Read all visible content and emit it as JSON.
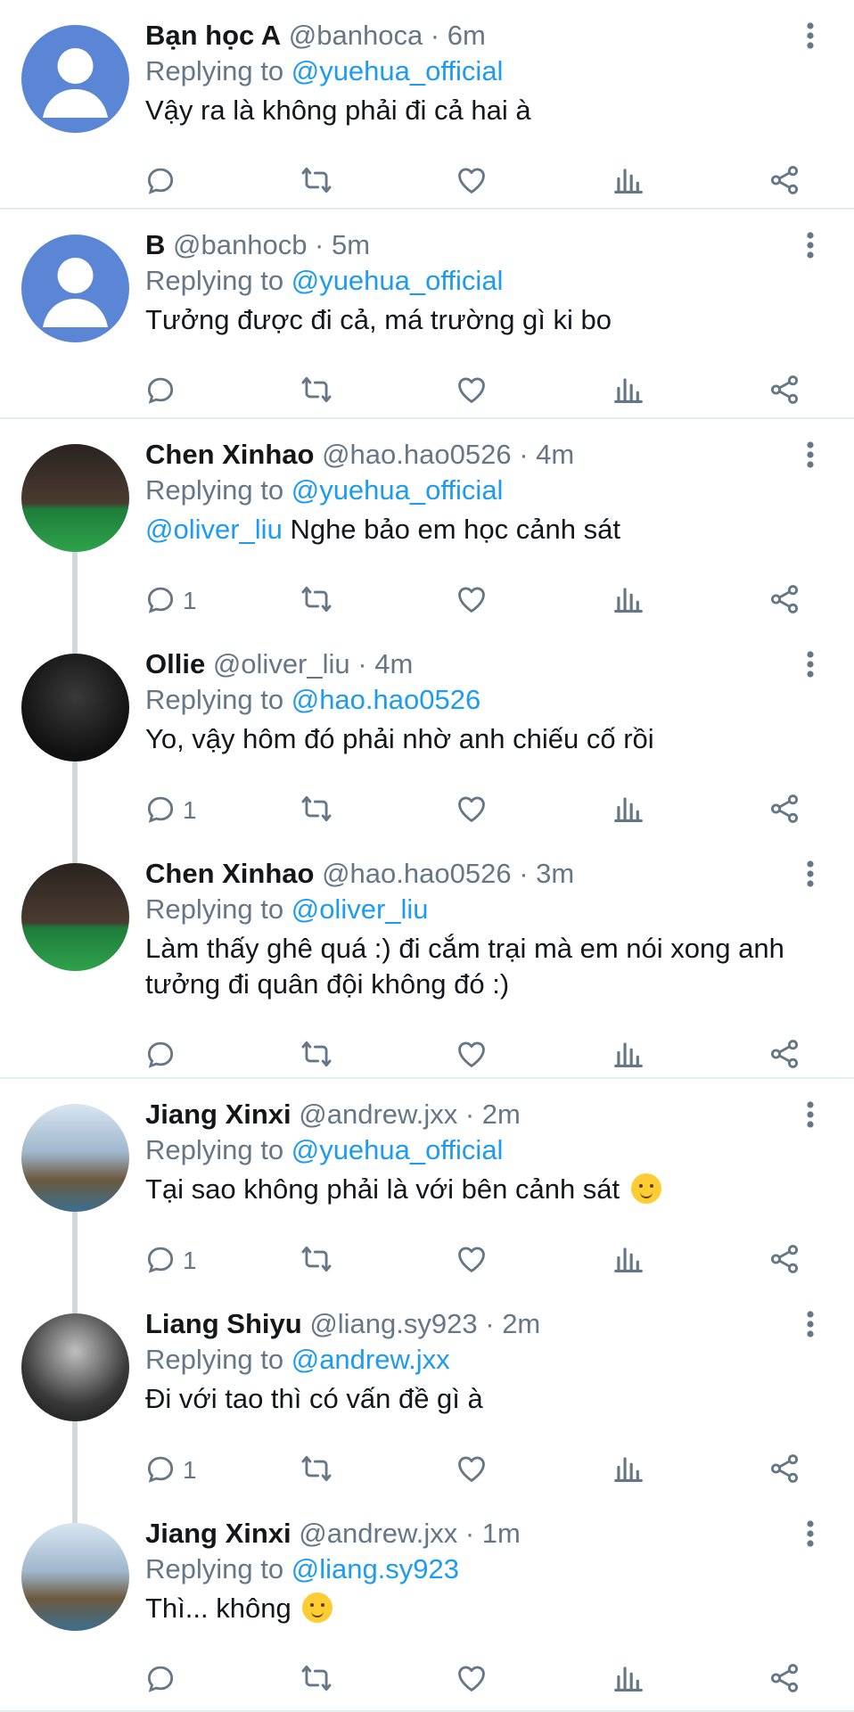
{
  "tweets": [
    {
      "name": "Bạn học A",
      "handle": "@banhoca",
      "time": "6m",
      "replying_prefix": "Replying to",
      "replying_to": "@yuehua_official",
      "mention": "",
      "text": "Vậy ra là không phải đi cả hai à",
      "emoji": "",
      "reply_count": "",
      "avatar": "default-avatar-icon",
      "thread": "none"
    },
    {
      "name": "B",
      "handle": "@banhocb",
      "time": "5m",
      "replying_prefix": "Replying to",
      "replying_to": "@yuehua_official",
      "mention": "",
      "text": "Tưởng được đi cả, má trường gì ki bo",
      "emoji": "",
      "reply_count": "",
      "avatar": "default-avatar-icon",
      "thread": "none"
    },
    {
      "name": "Chen Xinhao",
      "handle": "@hao.hao0526",
      "time": "4m",
      "replying_prefix": "Replying to",
      "replying_to": "@yuehua_official",
      "mention": "@oliver_liu",
      "text": "Nghe bảo em học cảnh sát",
      "emoji": "",
      "reply_count": "1",
      "avatar": "photo-avatar",
      "thread": "start"
    },
    {
      "name": "Ollie",
      "handle": "@oliver_liu",
      "time": "4m",
      "replying_prefix": "Replying to",
      "replying_to": "@hao.hao0526",
      "mention": "",
      "text": "Yo, vậy hôm đó phải nhờ anh chiếu cố rồi",
      "emoji": "",
      "reply_count": "1",
      "avatar": "photo-avatar",
      "thread": "middle"
    },
    {
      "name": "Chen Xinhao",
      "handle": "@hao.hao0526",
      "time": "3m",
      "replying_prefix": "Replying to",
      "replying_to": "@oliver_liu",
      "mention": "",
      "text": "Làm thấy ghê quá :) đi cắm trại mà em nói xong anh tưởng đi quân đội không đó :)",
      "emoji": "",
      "reply_count": "",
      "avatar": "photo-avatar",
      "thread": "end"
    },
    {
      "name": "Jiang Xinxi",
      "handle": "@andrew.jxx",
      "time": "2m",
      "replying_prefix": "Replying to",
      "replying_to": "@yuehua_official",
      "mention": "",
      "text": "Tại sao không phải là với bên cảnh sát",
      "emoji": "🥲",
      "reply_count": "1",
      "avatar": "photo-avatar",
      "thread": "start"
    },
    {
      "name": "Liang Shiyu",
      "handle": "@liang.sy923",
      "time": "2m",
      "replying_prefix": "Replying to",
      "replying_to": "@andrew.jxx",
      "mention": "",
      "text": "Đi với tao thì có vấn đề gì à",
      "emoji": "",
      "reply_count": "1",
      "avatar": "photo-avatar",
      "thread": "middle"
    },
    {
      "name": "Jiang Xinxi",
      "handle": "@andrew.jxx",
      "time": "1m",
      "replying_prefix": "Replying to",
      "replying_to": "@liang.sy923",
      "mention": "",
      "text": "Thì... không",
      "emoji": "🥲",
      "reply_count": "",
      "avatar": "photo-avatar",
      "thread": "end"
    }
  ],
  "colors": {
    "link": "#1d9bf0",
    "muted": "#657786",
    "divider": "#e6ecf0",
    "thread_line": "#cfd9de"
  },
  "icons": [
    "reply-icon",
    "retweet-icon",
    "like-icon",
    "analytics-icon",
    "share-icon",
    "more-options-icon"
  ]
}
